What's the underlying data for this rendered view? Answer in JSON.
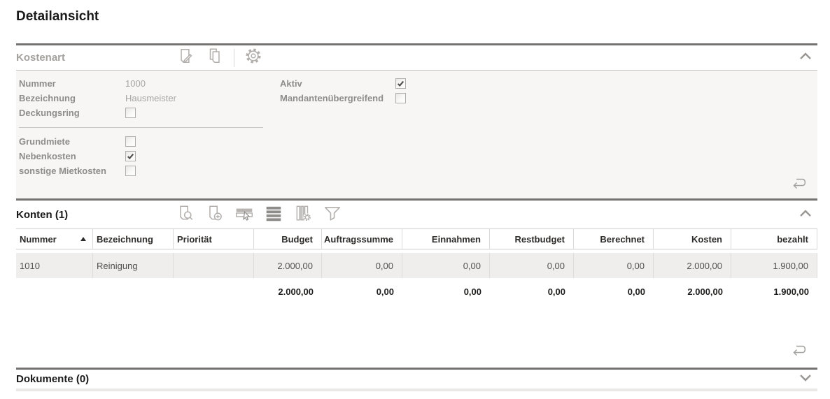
{
  "page": {
    "title": "Detailansicht"
  },
  "colors": {
    "section_line": "#757371",
    "panel_bg": "#f7f6f5",
    "row_bg": "#efeeed",
    "icon_gray": "#b2afac",
    "icon_dark": "#8f8d8a"
  },
  "sections": {
    "kostenart": {
      "title": "Kostenart",
      "expanded": true,
      "toolbar_icons": [
        "edit-document",
        "copy-document",
        "settings-gear"
      ],
      "fields_left_top": [
        {
          "label": "Nummer",
          "type": "text",
          "value": "1000"
        },
        {
          "label": "Bezeichnung",
          "type": "text",
          "value": "Hausmeister"
        },
        {
          "label": "Deckungsring",
          "type": "checkbox",
          "checked": false
        }
      ],
      "fields_left_bottom": [
        {
          "label": "Grundmiete",
          "type": "checkbox",
          "checked": false
        },
        {
          "label": "Nebenkosten",
          "type": "checkbox",
          "checked": true
        },
        {
          "label": "sonstige Mietkosten",
          "type": "checkbox",
          "checked": false
        }
      ],
      "fields_right": [
        {
          "label": "Aktiv",
          "type": "checkbox",
          "checked": true
        },
        {
          "label": "Mandantenübergreifend",
          "type": "checkbox",
          "checked": false
        }
      ]
    },
    "konten": {
      "title": "Konten (1)",
      "expanded": true,
      "toolbar_icons": [
        "view-document",
        "add-document",
        "select-rows",
        "rows-view",
        "column-settings",
        "filter-funnel"
      ],
      "table": {
        "sort": {
          "column": "Nummer",
          "direction": "asc"
        },
        "columns": [
          "Nummer",
          "Bezeichnung",
          "Priorität",
          "Budget",
          "Auftragssumme",
          "Einnahmen",
          "Restbudget",
          "Berechnet",
          "Kosten",
          "bezahlt"
        ],
        "rows": [
          [
            "1010",
            "Reinigung",
            "",
            "2.000,00",
            "0,00",
            "0,00",
            "0,00",
            "0,00",
            "2.000,00",
            "1.900,00"
          ]
        ],
        "totals": [
          "",
          "",
          "",
          "2.000,00",
          "0,00",
          "0,00",
          "0,00",
          "0,00",
          "2.000,00",
          "1.900,00"
        ]
      }
    },
    "dokumente": {
      "title": "Dokumente (0)",
      "expanded": false
    }
  }
}
